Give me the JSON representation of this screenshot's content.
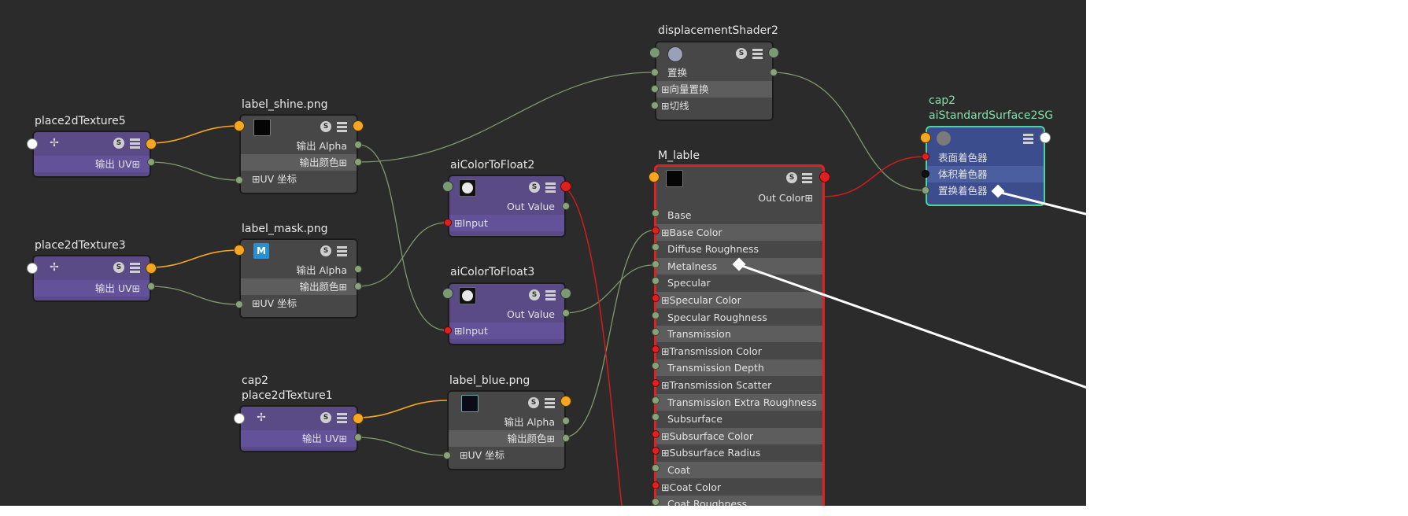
{
  "colors": {
    "canvas": "#2b2b2b",
    "wire_default": "#7f9a6c",
    "wire_orange": "#f5a623",
    "wire_red": "#d01c1c",
    "selected_border": "#e02121"
  },
  "icons": {
    "place2d": "place2d-texture-icon",
    "file": "file-texture-icon",
    "shader": "shader-icon",
    "sg": "shading-group-icon"
  },
  "nodes": {
    "place2dTexture5": {
      "title": "place2dTexture5",
      "out_uv": "输出 UV⊞"
    },
    "place2dTexture3": {
      "title": "place2dTexture3",
      "out_uv": "输出 UV⊞"
    },
    "place2dTexture1": {
      "title_top": "cap2",
      "title": "place2dTexture1",
      "out_uv": "输出 UV⊞"
    },
    "label_shine": {
      "title": "label_shine.png",
      "out_alpha": "输出 Alpha",
      "out_color": "输出颜色⊞",
      "uv": "⊞UV 坐标"
    },
    "label_mask": {
      "title": "label_mask.png",
      "icon_letter": "M",
      "out_alpha": "输出 Alpha",
      "out_color": "输出颜色⊞",
      "uv": "⊞UV 坐标"
    },
    "label_blue": {
      "title": "label_blue.png",
      "out_alpha": "输出 Alpha",
      "out_color": "输出颜色⊞",
      "uv": "⊞UV 坐标"
    },
    "aiColorToFloat2": {
      "title": "aiColorToFloat2",
      "out_value": "Out Value",
      "input": "⊞Input"
    },
    "aiColorToFloat3": {
      "title": "aiColorToFloat3",
      "out_value": "Out Value",
      "input": "⊞Input"
    },
    "displacementShader2": {
      "title": "displacementShader2",
      "rows": [
        "置换",
        "⊞向量置换",
        "⊞切线"
      ]
    },
    "M_lable": {
      "title": "M_lable",
      "out_color": "Out Color⊞",
      "attrs": [
        {
          "label": "Base",
          "port": "g"
        },
        {
          "label": "⊞Base Color",
          "port": "r"
        },
        {
          "label": "Diffuse Roughness",
          "port": "g"
        },
        {
          "label": "Metalness",
          "port": "g"
        },
        {
          "label": "Specular",
          "port": "g"
        },
        {
          "label": "⊞Specular Color",
          "port": "r"
        },
        {
          "label": "Specular Roughness",
          "port": "g"
        },
        {
          "label": "Transmission",
          "port": "g"
        },
        {
          "label": "⊞Transmission Color",
          "port": "r"
        },
        {
          "label": "Transmission Depth",
          "port": "g"
        },
        {
          "label": "⊞Transmission Scatter",
          "port": "r"
        },
        {
          "label": "Transmission Extra Roughness",
          "port": "g"
        },
        {
          "label": "Subsurface",
          "port": "g"
        },
        {
          "label": "⊞Subsurface Color",
          "port": "r"
        },
        {
          "label": "⊞Subsurface Radius",
          "port": "r"
        },
        {
          "label": "Coat",
          "port": "g"
        },
        {
          "label": "⊞Coat Color",
          "port": "r"
        },
        {
          "label": "Coat Roughness",
          "port": "g"
        }
      ]
    },
    "sg": {
      "title_top": "cap2",
      "title": "aiStandardSurface2SG",
      "rows": [
        "表面着色器",
        "体积着色器",
        "置换着色器"
      ]
    }
  }
}
